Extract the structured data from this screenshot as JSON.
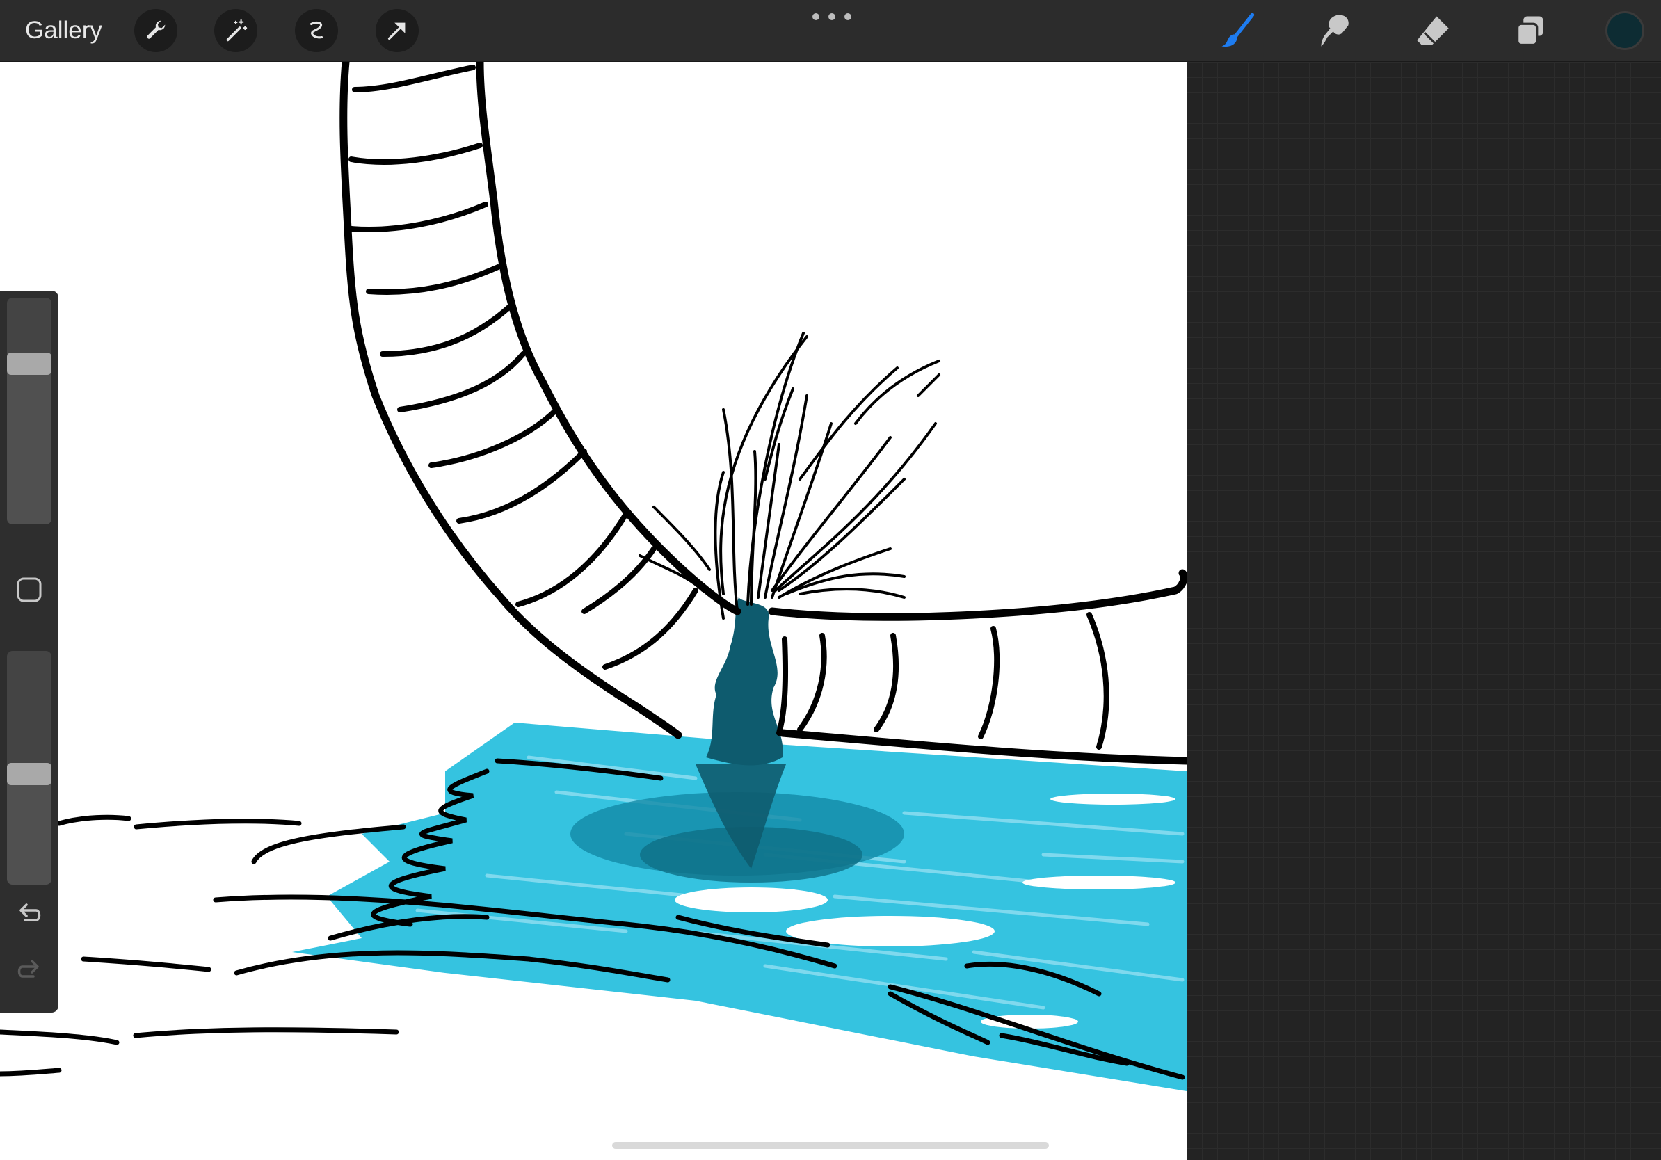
{
  "toolbar": {
    "gallery_label": "Gallery",
    "left_tools": [
      "wrench-icon",
      "magic-wand-icon",
      "selection-icon",
      "transform-arrow-icon"
    ],
    "right_tools": [
      "brush-icon",
      "smudge-icon",
      "eraser-icon",
      "layers-icon"
    ],
    "active_tool": "brush",
    "accent_color": "#1e7cf0",
    "current_color": "#0d2c33"
  },
  "sidebar": {
    "brush_size": 0.73,
    "brush_opacity": 0.47
  },
  "palette": {
    "canvas": "#ffffff",
    "ink": "#000000",
    "water_light": "#35c3e0",
    "water_dark": "#0e5b6e"
  }
}
